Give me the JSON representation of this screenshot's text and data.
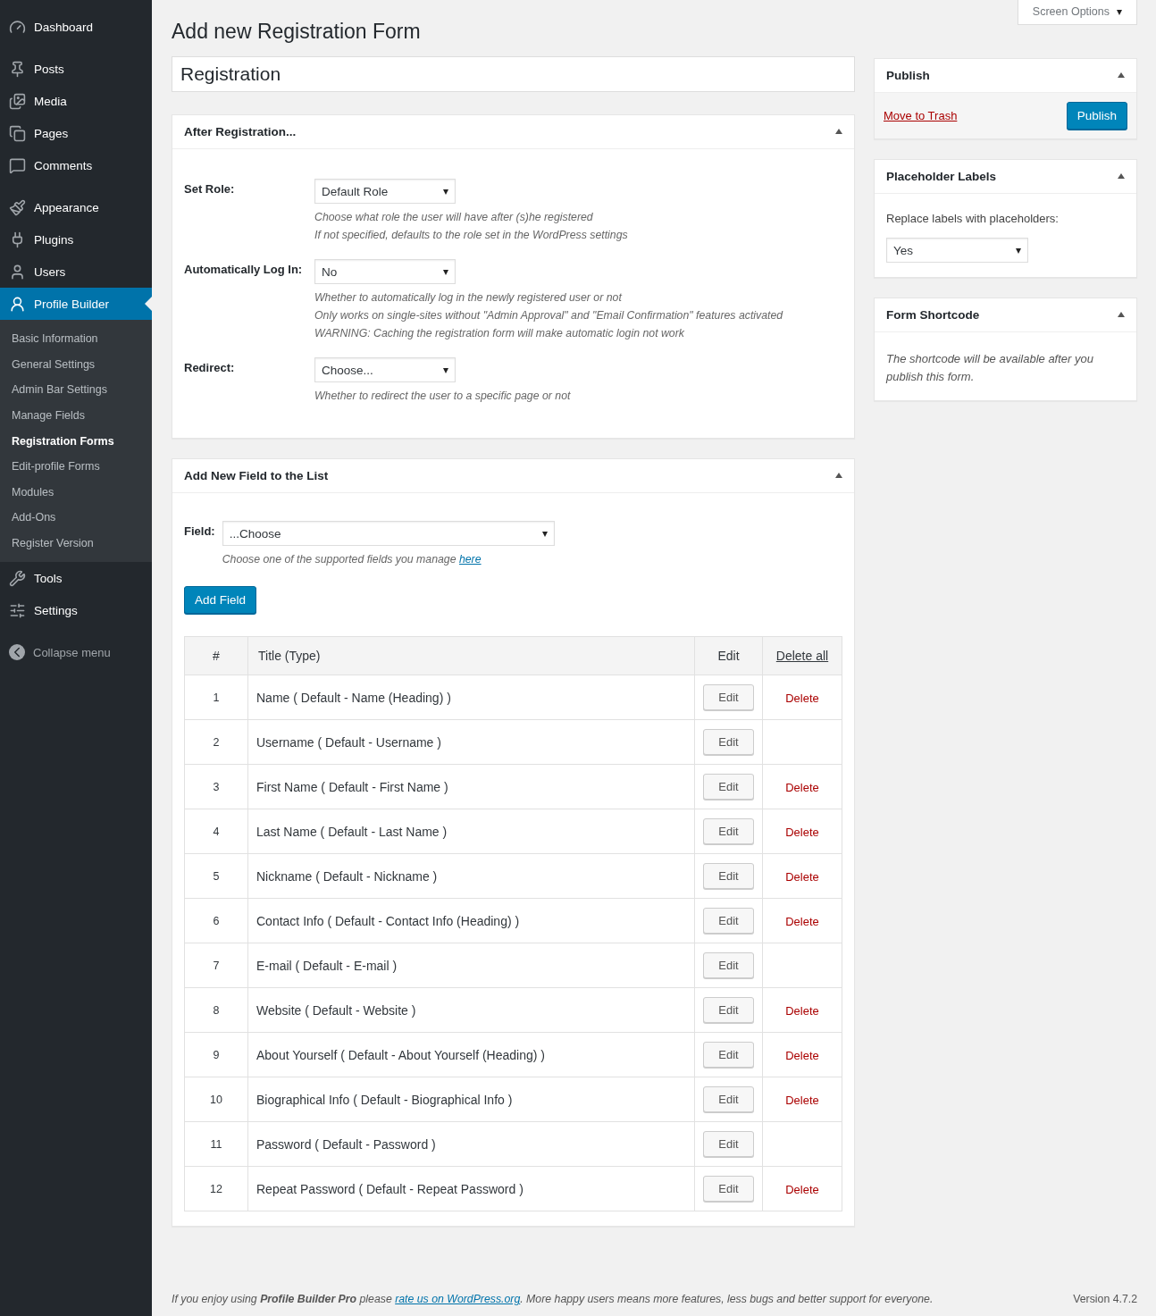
{
  "sidebar": {
    "sections": [
      [
        {
          "label": "Dashboard",
          "selected": false
        }
      ],
      [
        {
          "label": "Posts",
          "selected": false
        },
        {
          "label": "Media",
          "selected": false
        },
        {
          "label": "Pages",
          "selected": false
        },
        {
          "label": "Comments",
          "selected": false
        }
      ],
      [
        {
          "label": "Appearance",
          "selected": false
        },
        {
          "label": "Plugins",
          "selected": false
        },
        {
          "label": "Users",
          "selected": false
        },
        {
          "label": "Profile Builder",
          "selected": true,
          "children": [
            {
              "label": "Basic Information",
              "selected": false
            },
            {
              "label": "General Settings",
              "selected": false
            },
            {
              "label": "Admin Bar Settings",
              "selected": false
            },
            {
              "label": "Manage Fields",
              "selected": false
            },
            {
              "label": "Registration Forms",
              "selected": true
            },
            {
              "label": "Edit-profile Forms",
              "selected": false
            },
            {
              "label": "Modules",
              "selected": false
            },
            {
              "label": "Add-Ons",
              "selected": false
            },
            {
              "label": "Register Version",
              "selected": false
            }
          ]
        },
        {
          "label": "Tools",
          "selected": false
        },
        {
          "label": "Settings",
          "selected": false
        }
      ]
    ],
    "collapse_label": "Collapse menu"
  },
  "screen_options": "Screen Options",
  "page_title": "Add new Registration Form",
  "title_field": {
    "value": "Registration"
  },
  "after_registration": {
    "title": "After Registration...",
    "settings": [
      {
        "label": "Set Role:",
        "value": "Default Role",
        "help": [
          "Choose what role the user will have after (s)he registered",
          "If not specified, defaults to the role set in the WordPress settings"
        ]
      },
      {
        "label": "Automatically Log In:",
        "value": "No",
        "help": [
          "Whether to automatically log in the newly registered user or not",
          "Only works on single-sites without \"Admin Approval\" and \"Email Confirmation\" features activated",
          "WARNING: Caching the registration form will make automatic login not work"
        ]
      },
      {
        "label": "Redirect:",
        "value": "Choose...",
        "help": [
          "Whether to redirect the user to a specific page or not"
        ]
      }
    ]
  },
  "add_field": {
    "title": "Add New Field to the List",
    "label": "Field:",
    "value": "...Choose",
    "help": "Choose one of the supported fields you manage",
    "help_link": "here",
    "button": "Add Field",
    "table": {
      "columns": [
        "#",
        "Title (Type)",
        "Edit",
        "Delete all"
      ],
      "rows": [
        {
          "number": "1",
          "title": "Name ( Default - Name (Heading) )",
          "edit": "Edit",
          "delete": "Delete"
        },
        {
          "number": "2",
          "title": "Username ( Default - Username )",
          "edit": "Edit"
        },
        {
          "number": "3",
          "title": "First Name ( Default - First Name )",
          "edit": "Edit",
          "delete": "Delete"
        },
        {
          "number": "4",
          "title": "Last Name ( Default - Last Name )",
          "edit": "Edit",
          "delete": "Delete"
        },
        {
          "number": "5",
          "title": "Nickname ( Default - Nickname )",
          "edit": "Edit",
          "delete": "Delete"
        },
        {
          "number": "6",
          "title": "Contact Info ( Default - Contact Info (Heading) )",
          "edit": "Edit",
          "delete": "Delete"
        },
        {
          "number": "7",
          "title": "E-mail ( Default - E-mail )",
          "edit": "Edit"
        },
        {
          "number": "8",
          "title": "Website ( Default - Website )",
          "edit": "Edit",
          "delete": "Delete"
        },
        {
          "number": "9",
          "title": "About Yourself ( Default - About Yourself (Heading) )",
          "edit": "Edit",
          "delete": "Delete"
        },
        {
          "number": "10",
          "title": "Biographical Info ( Default - Biographical Info )",
          "edit": "Edit",
          "delete": "Delete"
        },
        {
          "number": "11",
          "title": "Password ( Default - Password )",
          "edit": "Edit"
        },
        {
          "number": "12",
          "title": "Repeat Password ( Default - Repeat Password )",
          "edit": "Edit",
          "delete": "Delete"
        }
      ]
    }
  },
  "publish": {
    "title": "Publish",
    "trash": "Move to Trash",
    "button": "Publish"
  },
  "placeholder_labels": {
    "title": "Placeholder Labels",
    "label": "Replace labels with placeholders:",
    "value": "Yes"
  },
  "form_shortcode": {
    "title": "Form Shortcode",
    "text": "The shortcode will be available after you publish this form."
  },
  "footer": {
    "text": "If you enjoy using **Profile Builder Pro** please",
    "link": "rate us on WordPress.org",
    "text_after": ". More happy users means more features, less bugs and better support for everyone.",
    "version": "Version 4.7.2"
  }
}
